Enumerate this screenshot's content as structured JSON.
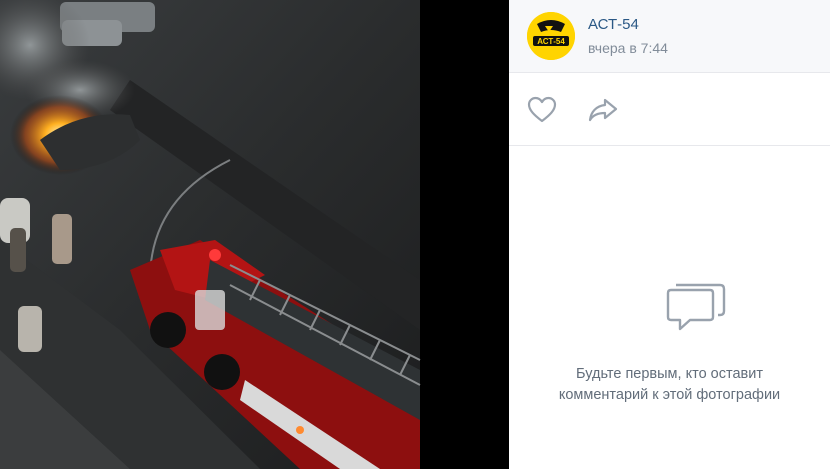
{
  "post": {
    "author": "АСТ-54",
    "date": "вчера в 7:44",
    "avatar_text": "АСТ-54"
  },
  "actions": {
    "like_icon": "heart-icon",
    "share_icon": "share-arrow-icon"
  },
  "comments": {
    "empty_line1": "Будьте первым, кто оставит",
    "empty_line2": "комментарий к этой фотографии",
    "icon": "comments-icon"
  },
  "colors": {
    "link": "#2a5885",
    "secondary_text": "#818c99",
    "avatar_bg": "#ffd400"
  }
}
